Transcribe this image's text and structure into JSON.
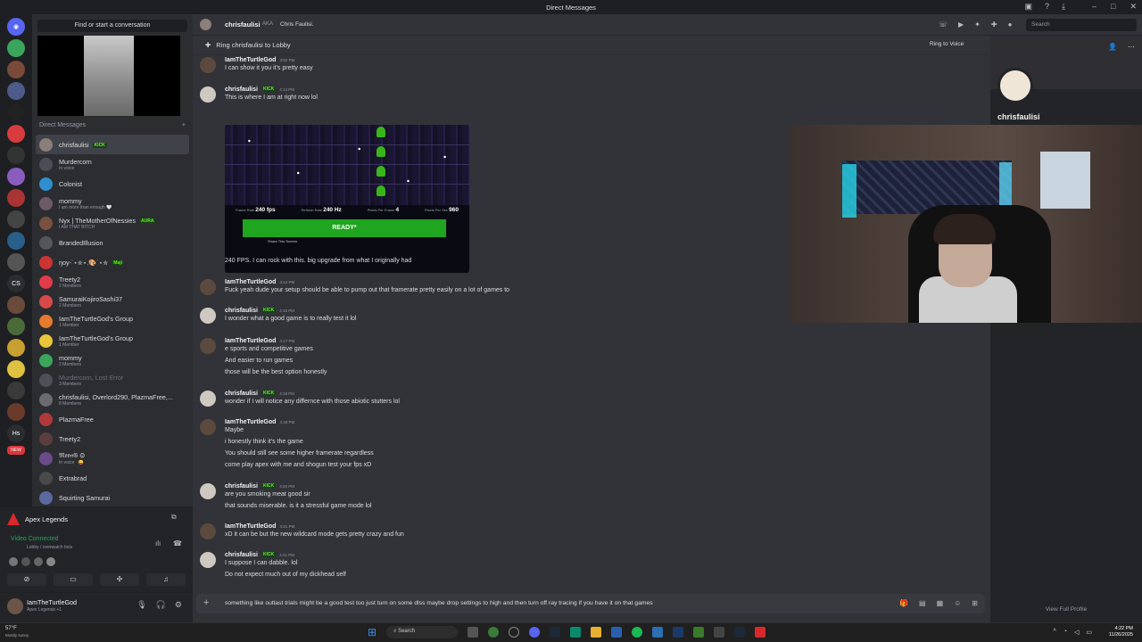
{
  "window": {
    "title": "Direct Messages"
  },
  "sidebar": {
    "find_label": "Find or start a conversation",
    "dm_header": "Direct Messages",
    "dm_add": "+",
    "items": [
      {
        "name": "chrisfaulisi",
        "sub": "",
        "tag": "KICK",
        "color": "#8a7f7a"
      },
      {
        "name": "Murdercorn",
        "sub": "In voice",
        "tag": "",
        "color": "#4d4d57"
      },
      {
        "name": "Colonist",
        "sub": "",
        "tag": "",
        "color": "#2f8fcf"
      },
      {
        "name": "mommy",
        "sub": "I am more than enough 🤍",
        "tag": "",
        "color": "#6e5a66"
      },
      {
        "name": "Nyx | TheMotherOfNessies",
        "sub": "I AM THAT BITCH",
        "tag": "AURA",
        "color": "#7a5040"
      },
      {
        "name": "BrandedIllusion",
        "sub": "",
        "tag": "",
        "color": "#55565c"
      },
      {
        "name": "ŋoy-˙⋆✮⋆.🎨˙⋆✮",
        "sub": "",
        "tag": "Maji",
        "color": "#c33"
      },
      {
        "name": "Treety2",
        "sub": "2 Members",
        "tag": "",
        "color": "#e23b4a"
      },
      {
        "name": "SamuraiKojiroSashi37",
        "sub": "2 Members",
        "tag": "",
        "color": "#d84a4a"
      },
      {
        "name": "IamTheTurtleGod's Group",
        "sub": "1 Member",
        "tag": "",
        "color": "#e87a2e"
      },
      {
        "name": "IamTheTurtleGod's Group",
        "sub": "1 Member",
        "tag": "",
        "color": "#e8c53a"
      },
      {
        "name": "mommy",
        "sub": "2 Members",
        "tag": "",
        "color": "#3ba55c"
      },
      {
        "name": "Murdercorn, Lost Error",
        "sub": "3 Members",
        "tag": "",
        "color": "#4e5058"
      },
      {
        "name": "chrisfaulisi, Overlord290, PlazmaFree,...",
        "sub": "8 Members",
        "tag": "",
        "color": "#6a6a70"
      },
      {
        "name": "PlazmaFree",
        "sub": "",
        "tag": "",
        "color": "#b03a3a"
      },
      {
        "name": "Treety2",
        "sub": "",
        "tag": "",
        "color": "#5c3e3e"
      },
      {
        "name": "𝔐𝔬𝔬𝔫𝔊 ⚙",
        "sub": "In voice · 😜",
        "tag": "",
        "color": "#6b4a8a"
      },
      {
        "name": "Extrabrad",
        "sub": "",
        "tag": "",
        "color": "#4a4a4a"
      },
      {
        "name": "Squirting Samurai",
        "sub": "",
        "tag": "",
        "color": "#5a6aa0"
      }
    ]
  },
  "voice": {
    "game": "Apex Legends",
    "status": "Video Connected",
    "channel": "Lobby / overwatch bois"
  },
  "user": {
    "name": "IamTheTurtleGod",
    "status": "Apex Legends +1"
  },
  "header": {
    "name": "chrisfaulisi",
    "aka_label": "AKA",
    "aka": "Chris Faulisi.",
    "search": "Search"
  },
  "ring": {
    "text": "Ring chrisfaulisi to Lobby",
    "button": "Ring to Voice"
  },
  "messages": [
    {
      "author": "IamTheTurtleGod",
      "time": "3:52 PM",
      "lines": [
        "I can show it you it's pretty easy"
      ]
    },
    {
      "author": "chrisfaulisi",
      "time": "4:13 PM",
      "tag": "KICK",
      "lines": [
        "This is where I am at right now lol"
      ]
    },
    {
      "author": "",
      "time": "",
      "lines": [
        "240 FPS. I can rock with this. big upgrade from what I originally had"
      ]
    },
    {
      "author": "IamTheTurtleGod",
      "time": "4:14 PM",
      "lines": [
        "Fuck yeah dude your setup should be able to pump out that framerate pretty easily on a lot of games to"
      ]
    },
    {
      "author": "chrisfaulisi",
      "time": "4:16 PM",
      "tag": "KICK",
      "lines": [
        "I wonder what a good game is to really test it lol"
      ]
    },
    {
      "author": "IamTheTurtleGod",
      "time": "4:17 PM",
      "lines": [
        "e sports and competitive games",
        "And easier to run games",
        "those will be the best option honestly"
      ]
    },
    {
      "author": "chrisfaulisi",
      "time": "4:18 PM",
      "tag": "KICK",
      "lines": [
        "wonder if I will notice any differnce with those abiotic stutters lol"
      ]
    },
    {
      "author": "IamTheTurtleGod",
      "time": "4:18 PM",
      "lines": [
        "Maybe",
        "i honestly think it's the game",
        "You should still see some higher framerate regardless",
        "come play apex with me and shogun test your fps xD"
      ]
    },
    {
      "author": "chrisfaulisi",
      "time": "4:20 PM",
      "tag": "KICK",
      "lines": [
        "are you smoking meat good sir",
        "that sounds miserable. is it a stressful game mode lol"
      ]
    },
    {
      "author": "IamTheTurtleGod",
      "time": "4:21 PM",
      "lines": [
        "xD it can be but the new wildcard mode gets pretty crazy and fun"
      ]
    },
    {
      "author": "chrisfaulisi",
      "time": "4:21 PM",
      "tag": "KICK",
      "lines": [
        "I suppose I can dabble. lol",
        "Do not expect much out of my dickhead self"
      ]
    }
  ],
  "embed": {
    "stats": [
      {
        "label": "Frame Rate",
        "value": "240 fps"
      },
      {
        "label": "Refresh Rate",
        "value": "240 Hz"
      },
      {
        "label": "Pixels Per Frame",
        "value": "4"
      },
      {
        "label": "Pixels Per Sec",
        "value": "960"
      }
    ],
    "ready": "READY*",
    "share": "Share This Screen"
  },
  "composer": {
    "value": "something like outlast trials might be a good test too just turn on some dlss maybe drop settings to high and then turn off ray tracing if you have it on that games"
  },
  "profile": {
    "name": "chrisfaulisi",
    "view_full": "View Full Profile"
  },
  "taskbar": {
    "temp": "57°F",
    "weather": "Mostly sunny",
    "search": "Search",
    "time": "4:22 PM",
    "date": "11/26/2025"
  }
}
